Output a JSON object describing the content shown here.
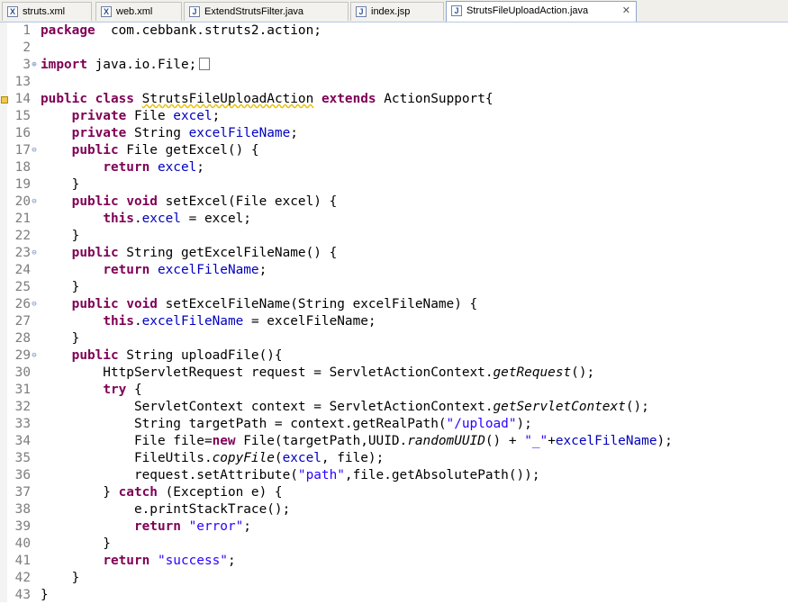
{
  "tabs": [
    {
      "label": "struts.xml",
      "icon": "xml-file-icon",
      "active": false
    },
    {
      "label": "web.xml",
      "icon": "xml-file-icon",
      "active": false
    },
    {
      "label": "ExtendStrutsFilter.java",
      "icon": "java-file-icon",
      "active": false
    },
    {
      "label": "index.jsp",
      "icon": "jsp-file-icon",
      "active": false
    },
    {
      "label": "StrutsFileUploadAction.java",
      "icon": "java-file-icon",
      "active": true,
      "close": "✕"
    }
  ],
  "lines": [
    {
      "n": "1",
      "tokens": [
        [
          "kw",
          "package"
        ],
        [
          "",
          "  com.cebbank.struts2.action;"
        ]
      ]
    },
    {
      "n": "2",
      "tokens": []
    },
    {
      "n": "3",
      "fold": "⊕",
      "tokens": [
        [
          "kw",
          "import"
        ],
        [
          "",
          " java.io.File;"
        ]
      ],
      "collapsed": true
    },
    {
      "n": "13",
      "tokens": []
    },
    {
      "n": "14",
      "marker": true,
      "tokens": [
        [
          "kw",
          "public"
        ],
        [
          "",
          " "
        ],
        [
          "kw",
          "class"
        ],
        [
          "",
          " "
        ],
        [
          "warn",
          "StrutsFileUploadAction"
        ],
        [
          "",
          " "
        ],
        [
          "kw",
          "extends"
        ],
        [
          "",
          " ActionSupport{"
        ]
      ]
    },
    {
      "n": "15",
      "tokens": [
        [
          "",
          "    "
        ],
        [
          "kw",
          "private"
        ],
        [
          "",
          " File "
        ],
        [
          "fld",
          "excel"
        ],
        [
          "",
          ";"
        ]
      ]
    },
    {
      "n": "16",
      "tokens": [
        [
          "",
          "    "
        ],
        [
          "kw",
          "private"
        ],
        [
          "",
          " String "
        ],
        [
          "fld",
          "excelFileName"
        ],
        [
          "",
          ";"
        ]
      ]
    },
    {
      "n": "17",
      "fold": "⊖",
      "tokens": [
        [
          "",
          "    "
        ],
        [
          "kw",
          "public"
        ],
        [
          "",
          " File getExcel() {"
        ]
      ]
    },
    {
      "n": "18",
      "tokens": [
        [
          "",
          "        "
        ],
        [
          "kw",
          "return"
        ],
        [
          "",
          " "
        ],
        [
          "fld",
          "excel"
        ],
        [
          "",
          ";"
        ]
      ]
    },
    {
      "n": "19",
      "tokens": [
        [
          "",
          "    }"
        ]
      ]
    },
    {
      "n": "20",
      "fold": "⊖",
      "tokens": [
        [
          "",
          "    "
        ],
        [
          "kw",
          "public"
        ],
        [
          "",
          " "
        ],
        [
          "kw",
          "void"
        ],
        [
          "",
          " setExcel(File excel) {"
        ]
      ]
    },
    {
      "n": "21",
      "tokens": [
        [
          "",
          "        "
        ],
        [
          "kw",
          "this"
        ],
        [
          "",
          "."
        ],
        [
          "fld",
          "excel"
        ],
        [
          "",
          " = excel;"
        ]
      ]
    },
    {
      "n": "22",
      "tokens": [
        [
          "",
          "    }"
        ]
      ]
    },
    {
      "n": "23",
      "fold": "⊖",
      "tokens": [
        [
          "",
          "    "
        ],
        [
          "kw",
          "public"
        ],
        [
          "",
          " String getExcelFileName() {"
        ]
      ]
    },
    {
      "n": "24",
      "tokens": [
        [
          "",
          "        "
        ],
        [
          "kw",
          "return"
        ],
        [
          "",
          " "
        ],
        [
          "fld",
          "excelFileName"
        ],
        [
          "",
          ";"
        ]
      ]
    },
    {
      "n": "25",
      "tokens": [
        [
          "",
          "    }"
        ]
      ]
    },
    {
      "n": "26",
      "fold": "⊖",
      "tokens": [
        [
          "",
          "    "
        ],
        [
          "kw",
          "public"
        ],
        [
          "",
          " "
        ],
        [
          "kw",
          "void"
        ],
        [
          "",
          " setExcelFileName(String excelFileName) {"
        ]
      ]
    },
    {
      "n": "27",
      "tokens": [
        [
          "",
          "        "
        ],
        [
          "kw",
          "this"
        ],
        [
          "",
          "."
        ],
        [
          "fld",
          "excelFileName"
        ],
        [
          "",
          " = excelFileName;"
        ]
      ]
    },
    {
      "n": "28",
      "tokens": [
        [
          "",
          "    }"
        ]
      ]
    },
    {
      "n": "29",
      "fold": "⊖",
      "tokens": [
        [
          "",
          "    "
        ],
        [
          "kw",
          "public"
        ],
        [
          "",
          " String uploadFile(){"
        ]
      ]
    },
    {
      "n": "30",
      "tokens": [
        [
          "",
          "        HttpServletRequest request = ServletActionContext."
        ],
        [
          "sm",
          "getRequest"
        ],
        [
          "",
          "();"
        ]
      ]
    },
    {
      "n": "31",
      "tokens": [
        [
          "",
          "        "
        ],
        [
          "kw",
          "try"
        ],
        [
          "",
          " {"
        ]
      ]
    },
    {
      "n": "32",
      "tokens": [
        [
          "",
          "            ServletContext context = ServletActionContext."
        ],
        [
          "sm",
          "getServletContext"
        ],
        [
          "",
          "();"
        ]
      ]
    },
    {
      "n": "33",
      "tokens": [
        [
          "",
          "            String targetPath = context.getRealPath("
        ],
        [
          "str",
          "\"/upload\""
        ],
        [
          "",
          ");"
        ]
      ]
    },
    {
      "n": "34",
      "tokens": [
        [
          "",
          "            File file="
        ],
        [
          "kw",
          "new"
        ],
        [
          "",
          " File(targetPath,UUID."
        ],
        [
          "sm",
          "randomUUID"
        ],
        [
          "",
          "() + "
        ],
        [
          "str",
          "\"_\""
        ],
        [
          "",
          "+"
        ],
        [
          "fld",
          "excelFileName"
        ],
        [
          "",
          ");"
        ]
      ]
    },
    {
      "n": "35",
      "tokens": [
        [
          "",
          "            FileUtils."
        ],
        [
          "sm",
          "copyFile"
        ],
        [
          "",
          "("
        ],
        [
          "fld",
          "excel"
        ],
        [
          "",
          ", file);"
        ]
      ]
    },
    {
      "n": "36",
      "tokens": [
        [
          "",
          "            request.setAttribute("
        ],
        [
          "str",
          "\"path\""
        ],
        [
          "",
          ",file.getAbsolutePath());"
        ]
      ]
    },
    {
      "n": "37",
      "tokens": [
        [
          "",
          "        } "
        ],
        [
          "kw",
          "catch"
        ],
        [
          "",
          " (Exception e) {"
        ]
      ]
    },
    {
      "n": "38",
      "tokens": [
        [
          "",
          "            e.printStackTrace();"
        ]
      ]
    },
    {
      "n": "39",
      "tokens": [
        [
          "",
          "            "
        ],
        [
          "kw",
          "return"
        ],
        [
          "",
          " "
        ],
        [
          "str",
          "\"error\""
        ],
        [
          "",
          ";"
        ]
      ]
    },
    {
      "n": "40",
      "tokens": [
        [
          "",
          "        }"
        ]
      ]
    },
    {
      "n": "41",
      "tokens": [
        [
          "",
          "        "
        ],
        [
          "kw",
          "return"
        ],
        [
          "",
          " "
        ],
        [
          "str",
          "\"success\""
        ],
        [
          "",
          ";"
        ]
      ]
    },
    {
      "n": "42",
      "tokens": [
        [
          "",
          "    }"
        ]
      ]
    },
    {
      "n": "43",
      "tokens": [
        [
          "",
          "}"
        ]
      ]
    }
  ]
}
